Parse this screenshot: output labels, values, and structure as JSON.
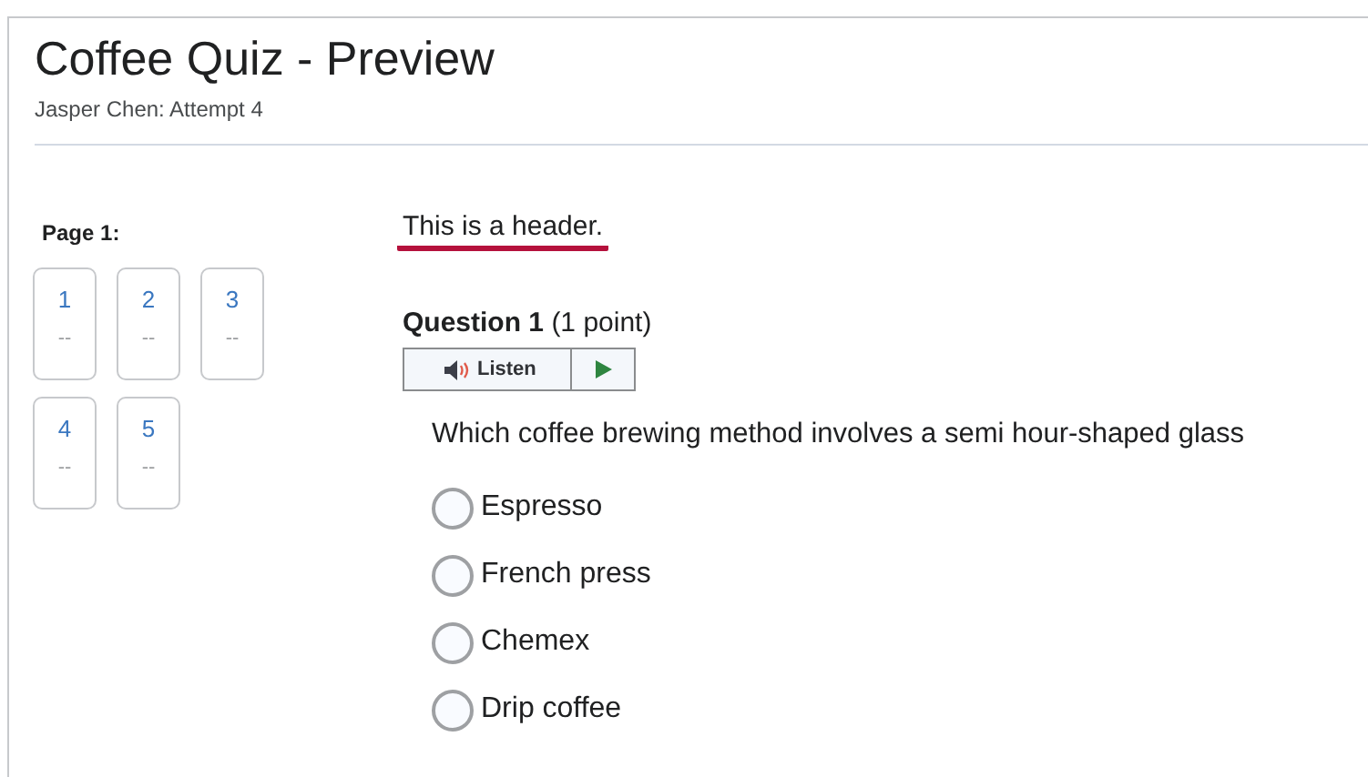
{
  "title": "Coffee Quiz - Preview",
  "subtitle": "Jasper Chen: Attempt 4",
  "page_label": "Page 1:",
  "questions_nav": [
    {
      "number": "1",
      "status": "--"
    },
    {
      "number": "2",
      "status": "--"
    },
    {
      "number": "3",
      "status": "--"
    },
    {
      "number": "4",
      "status": "--"
    },
    {
      "number": "5",
      "status": "--"
    }
  ],
  "header": "This is a header.",
  "question": {
    "title": "Question 1",
    "points": "(1 point)",
    "listen_label": "Listen",
    "text": "Which coffee brewing method involves a semi hour-shaped glass",
    "options": [
      {
        "label": "Espresso",
        "selected": false
      },
      {
        "label": "French press",
        "selected": false
      },
      {
        "label": "Chemex",
        "selected": false
      },
      {
        "label": "Drip coffee",
        "selected": false
      }
    ]
  }
}
